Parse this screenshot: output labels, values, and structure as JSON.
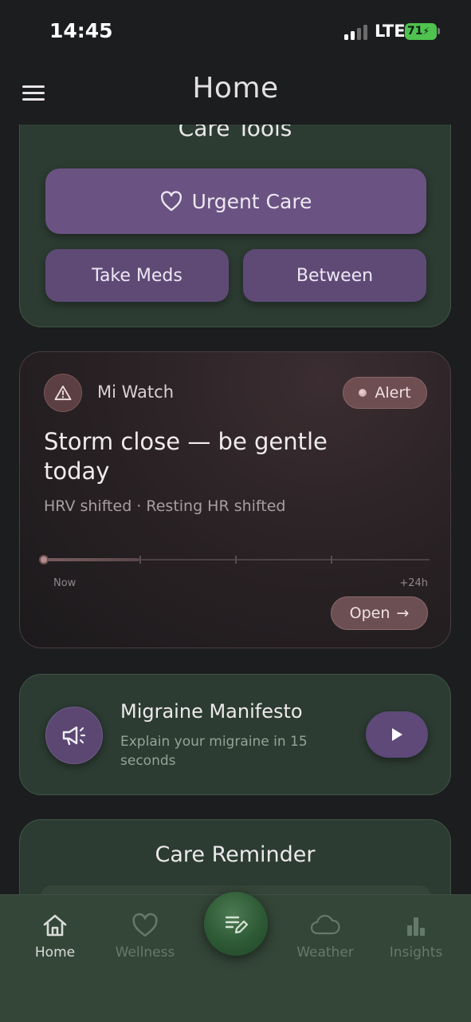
{
  "status_bar": {
    "time": "14:45",
    "network": "LTE",
    "battery": "71"
  },
  "header": {
    "title": "Home",
    "menu_icon": "hamburger-menu-icon"
  },
  "care_tools": {
    "title": "Care Tools",
    "urgent_label": "Urgent Care",
    "take_meds_label": "Take Meds",
    "between_label": "Between",
    "urgent_icon": "heart-icon"
  },
  "watch_card": {
    "source": "Mi Watch",
    "alert_label": "Alert",
    "headline": "Storm close — be gentle today",
    "subtitle": "HRV shifted · Resting HR shifted",
    "timeline_start": "Now",
    "timeline_end": "+24h",
    "open_label": "Open",
    "open_arrow": "→",
    "icon": "warning-icon",
    "accent_color": "#6e4e51"
  },
  "manifesto": {
    "title": "Migraine Manifesto",
    "subtitle": "Explain your migraine in 15 seconds",
    "icon": "megaphone-icon",
    "play_icon": "play-icon"
  },
  "reminder": {
    "title": "Care Reminder"
  },
  "nav": {
    "items": [
      {
        "label": "Home",
        "icon": "home-icon"
      },
      {
        "label": "Wellness",
        "icon": "heart-icon"
      },
      {
        "label": "Weather",
        "icon": "cloud-icon"
      },
      {
        "label": "Insights",
        "icon": "bar-chart-icon"
      }
    ],
    "fab_icon": "journal-edit-icon"
  },
  "colors": {
    "background": "#1c1d1f",
    "card_green": "#2c3c32",
    "button_purple": "#6a5282",
    "nav_bg": "#344638"
  }
}
